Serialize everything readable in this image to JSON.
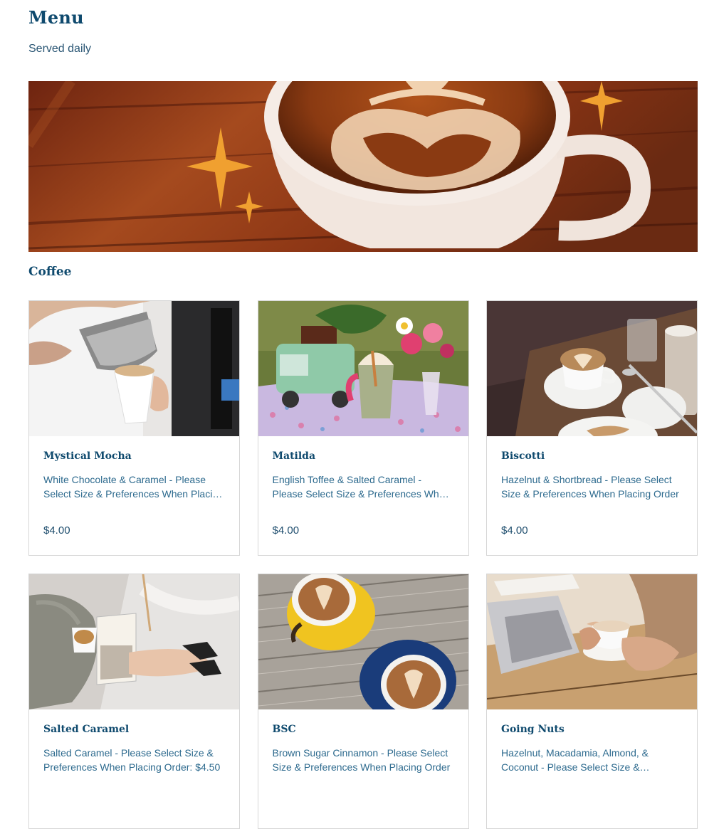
{
  "menu": {
    "title": "Menu",
    "subtitle": "Served daily"
  },
  "section": {
    "title": "Coffee"
  },
  "items": [
    {
      "name": "Mystical Mocha",
      "description": "White Chocolate & Caramel - Please Select Size & Preferences When Placing Order",
      "price": "$4.00"
    },
    {
      "name": "Matilda",
      "description": "English Toffee & Salted Caramel - Please Select Size & Preferences When Placing Order",
      "price": "$4.00"
    },
    {
      "name": "Biscotti",
      "description": "Hazelnut & Shortbread - Please Select Size & Preferences When Placing Order",
      "price": "$4.00"
    },
    {
      "name": "Salted Caramel",
      "description": "Salted Caramel - Please Select Size & Preferences When Placing Order: $4.50",
      "price": ""
    },
    {
      "name": "BSC",
      "description": "Brown Sugar Cinnamon - Please Select Size & Preferences When Placing Order",
      "price": ""
    },
    {
      "name": "Going Nuts",
      "description": "Hazelnut, Macadamia, Almond, & Coconut - Please Select Size & Preferences",
      "price": ""
    }
  ],
  "colors": {
    "heading": "#0f4a6e",
    "text": "#2d6a8e",
    "border": "#d6d6d6"
  }
}
